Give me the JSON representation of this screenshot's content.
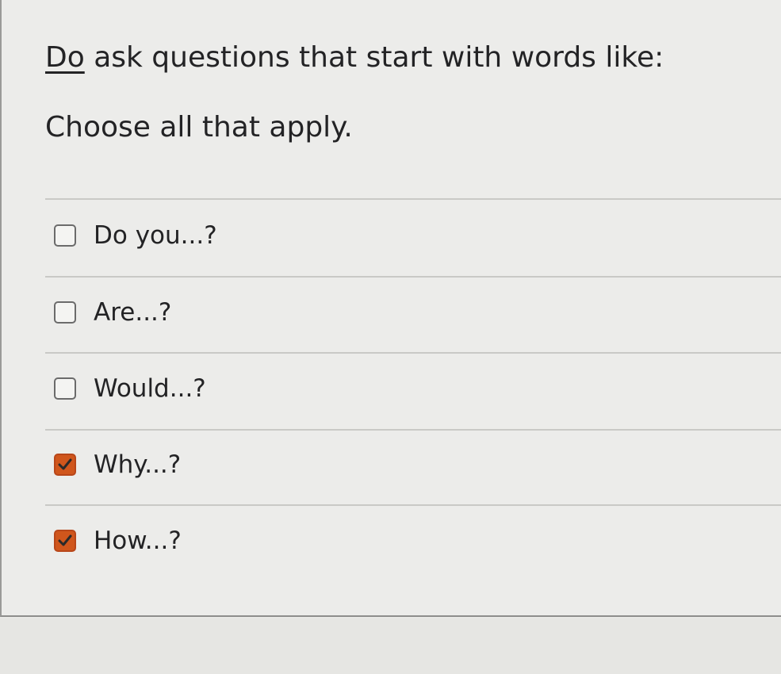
{
  "question": {
    "emphasis": "Do",
    "text": " ask questions that start with words like:"
  },
  "instruction": "Choose all that apply.",
  "options": [
    {
      "label": "Do you...?",
      "checked": false
    },
    {
      "label": "Are...?",
      "checked": false
    },
    {
      "label": "Would...?",
      "checked": false
    },
    {
      "label": "Why...?",
      "checked": true
    },
    {
      "label": "How...?",
      "checked": true
    }
  ],
  "colors": {
    "checked_fill": "#d0561c",
    "text": "#232325"
  }
}
